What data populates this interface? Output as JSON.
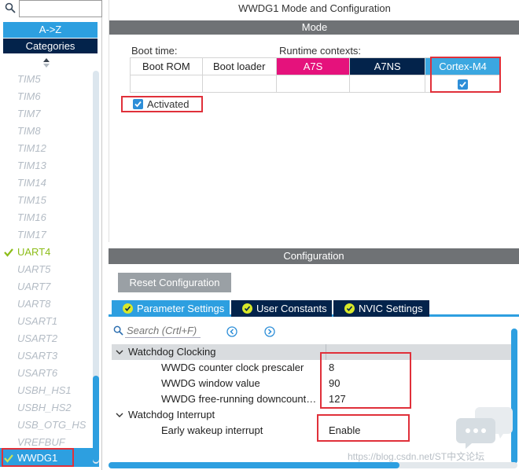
{
  "left_panel": {
    "search": {
      "value": "",
      "placeholder": ""
    },
    "sort_az_label": "A->Z",
    "categories_label": "Categories",
    "peripherals": [
      {
        "label": "TIM5",
        "state": "inactive"
      },
      {
        "label": "TIM6",
        "state": "inactive"
      },
      {
        "label": "TIM7",
        "state": "inactive"
      },
      {
        "label": "TIM8",
        "state": "inactive"
      },
      {
        "label": "TIM12",
        "state": "inactive"
      },
      {
        "label": "TIM13",
        "state": "inactive"
      },
      {
        "label": "TIM14",
        "state": "inactive"
      },
      {
        "label": "TIM15",
        "state": "inactive"
      },
      {
        "label": "TIM16",
        "state": "inactive"
      },
      {
        "label": "TIM17",
        "state": "inactive"
      },
      {
        "label": "UART4",
        "state": "active"
      },
      {
        "label": "UART5",
        "state": "inactive"
      },
      {
        "label": "UART7",
        "state": "inactive"
      },
      {
        "label": "UART8",
        "state": "inactive"
      },
      {
        "label": "USART1",
        "state": "inactive"
      },
      {
        "label": "USART2",
        "state": "inactive"
      },
      {
        "label": "USART3",
        "state": "inactive"
      },
      {
        "label": "USART6",
        "state": "inactive"
      },
      {
        "label": "USBH_HS1",
        "state": "inactive"
      },
      {
        "label": "USBH_HS2",
        "state": "inactive"
      },
      {
        "label": "USB_OTG_HS",
        "state": "inactive"
      },
      {
        "label": "VREFBUF",
        "state": "inactive"
      },
      {
        "label": "WWDG1",
        "state": "selected"
      }
    ]
  },
  "mode_panel": {
    "title": "WWDG1 Mode and Configuration",
    "section_label": "Mode",
    "boot_time_label": "Boot time:",
    "runtime_contexts_label": "Runtime contexts:",
    "columns": [
      "Boot ROM",
      "Boot loader",
      "A7S",
      "A7NS",
      "Cortex-M4"
    ],
    "cortex_m4_checked": true,
    "activated_label": "Activated",
    "activated_checked": true
  },
  "config_panel": {
    "section_label": "Configuration",
    "reset_button_label": "Reset Configuration",
    "tabs": [
      "Parameter Settings",
      "User Constants",
      "NVIC Settings"
    ],
    "search_placeholder": "Search (Crtl+F)",
    "groups": [
      {
        "name": "Watchdog Clocking",
        "params": [
          {
            "name": "WWDG counter clock prescaler",
            "value": "8"
          },
          {
            "name": "WWDG window value",
            "value": "90"
          },
          {
            "name": "WWDG free-running downcounter ...",
            "value": "127"
          }
        ]
      },
      {
        "name": "Watchdog Interrupt",
        "params": [
          {
            "name": "Early wakeup interrupt",
            "value": "Enable"
          }
        ]
      }
    ]
  },
  "watermark": {
    "text": "https://blog.csdn.net/ST中文论坛"
  },
  "colors": {
    "accent_blue": "#2d9fe0",
    "navy": "#03234b",
    "magenta": "#e5127c",
    "active_green": "#8dbd1a",
    "highlight_red": "#e0303a",
    "header_gray": "#6f7275"
  }
}
